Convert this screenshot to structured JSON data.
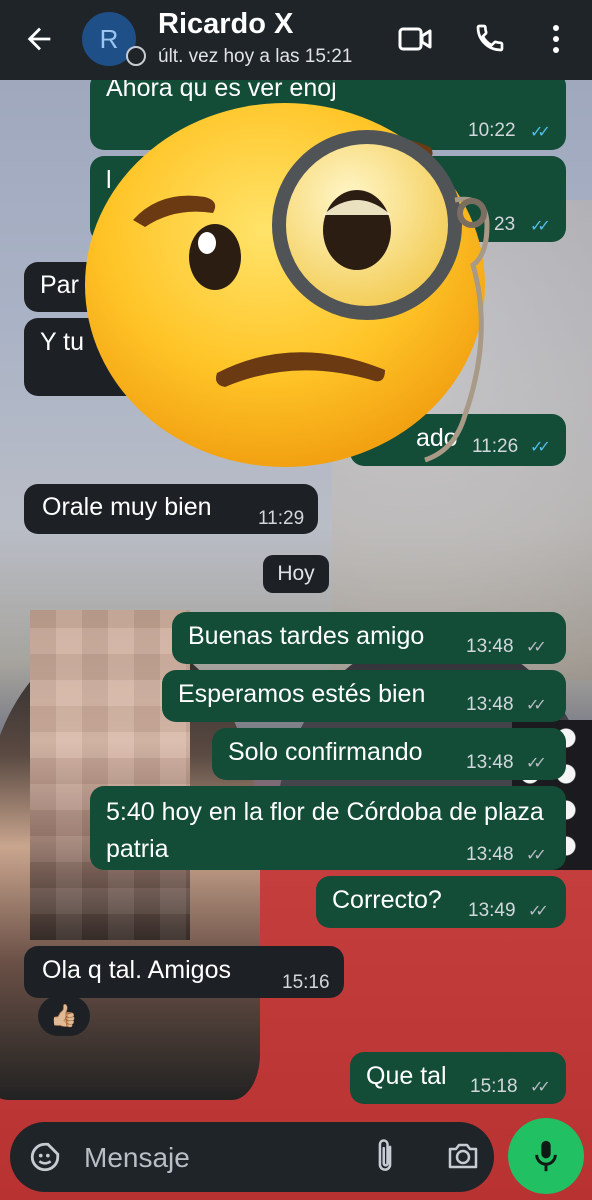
{
  "header": {
    "back_icon": "arrow-left-icon",
    "avatar_initial": "R",
    "contact_name": "Ricardo X",
    "last_seen": "últ. vez hoy a las 15:21",
    "video_icon": "video-camera-icon",
    "call_icon": "phone-icon",
    "menu_icon": "more-vert-icon"
  },
  "messages": [
    {
      "direction": "out",
      "text": "Ahora qu    es ver enoj",
      "time": "10:22",
      "status": "read"
    },
    {
      "direction": "out",
      "text": "l",
      "time": "23",
      "status": "read"
    },
    {
      "direction": "in",
      "text": "Par"
    },
    {
      "direction": "in",
      "text": "Y tu"
    },
    {
      "direction": "out",
      "text": "ado",
      "time": "11:26",
      "status": "read"
    },
    {
      "direction": "in",
      "text": "Orale muy bien",
      "time": "11:29"
    },
    {
      "direction": "out",
      "text": "Buenas tardes amigo",
      "time": "13:48",
      "status": "delivered"
    },
    {
      "direction": "out",
      "text": "Esperamos estés bien",
      "time": "13:48",
      "status": "delivered"
    },
    {
      "direction": "out",
      "text": "Solo confirmando",
      "time": "13:48",
      "status": "delivered"
    },
    {
      "direction": "out",
      "text": "5:40 hoy en la flor de Córdoba de plaza patria",
      "time": "13:48",
      "status": "delivered"
    },
    {
      "direction": "out",
      "text": "Correcto?",
      "time": "13:49",
      "status": "delivered"
    },
    {
      "direction": "in",
      "text": "Ola q tal. Amigos",
      "time": "15:16",
      "reaction": "👍🏼"
    },
    {
      "direction": "out",
      "text": "Que tal",
      "time": "15:18",
      "status": "delivered"
    }
  ],
  "day_divider": "Hoy",
  "composer": {
    "placeholder": "Mensaje",
    "sticker_icon": "sticker-icon",
    "attach_icon": "paperclip-icon",
    "camera_icon": "camera-icon",
    "mic_icon": "microphone-icon"
  },
  "overlay": {
    "emoji_icon": "face-with-monocle-emoji"
  },
  "colors": {
    "outgoing_bubble": "#134d37",
    "incoming_bubble": "#1d2126",
    "read_ticks": "#53bdeb",
    "mic_button": "#21c063",
    "header": "#1f2429"
  }
}
